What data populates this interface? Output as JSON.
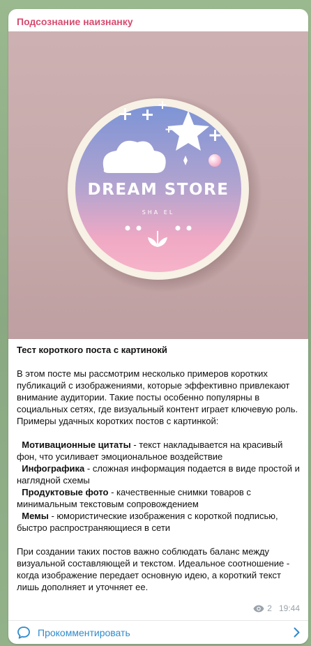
{
  "channel": {
    "name": "Подсознание наизнанку"
  },
  "image": {
    "logo_title": "DREAM STORE",
    "logo_subtitle": "SHA EL"
  },
  "post": {
    "title": "Тест короткого поста с картинокй",
    "intro": "В этом посте мы рассмотрим несколько примеров коротких публикаций с изображениями, которые эффективно привлекают внимание аудитории. Такие посты особенно популярны в социальных сетях, где визуальный контент играет ключевую роль.",
    "examples_heading": "Примеры удачных коротких постов с картинкой:",
    "items": [
      {
        "bold": "Мотивационные цитаты",
        "text": " - текст накладывается на красивый фон, что усиливает эмоциональное воздействие"
      },
      {
        "bold": "Инфографика",
        "text": " - сложная информация подается в виде простой и наглядной схемы"
      },
      {
        "bold": "Продуктовые фото",
        "text": " - качественные снимки товаров с минимальным текстовым сопровождением"
      },
      {
        "bold": "Мемы",
        "text": " - юмористические изображения с короткой подписью, быстро распространяющиеся в сети"
      }
    ],
    "conclusion": "При создании таких постов важно соблюдать баланс между визуальной составляющей и текстом. Идеальное соотношение - когда изображение передает основную идею, а короткий текст лишь дополняет и уточняет ее."
  },
  "meta": {
    "views": "2",
    "time": "19:44",
    "views_icon": "eye-icon"
  },
  "comments": {
    "label": "Прокомментировать",
    "icon": "comment-icon",
    "arrow_icon": "chevron-right-icon"
  },
  "colors": {
    "channel_name": "#d84a6e",
    "link": "#2f8acb",
    "meta": "#9aa3ab"
  }
}
